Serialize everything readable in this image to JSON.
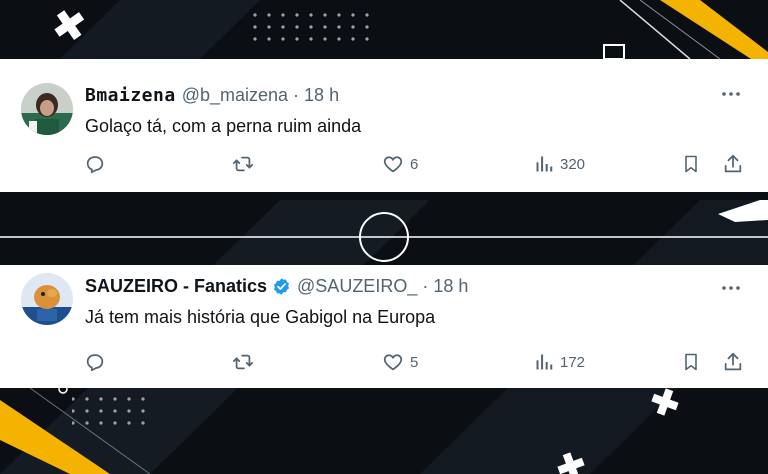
{
  "colors": {
    "background": "#0b0f14",
    "accent_yellow": "#f5b301",
    "verified_blue": "#1d9bf0",
    "text_primary": "#0f1419",
    "text_secondary": "#536471"
  },
  "tweets": [
    {
      "display_name": "Bmaizena",
      "handle": "@b_maizena",
      "separator": "·",
      "time": "18 h",
      "verified": false,
      "text": "Golaço tá, com a perna ruim ainda",
      "likes": "6",
      "views": "320"
    },
    {
      "display_name": "SAUZEIRO - Fanatics",
      "handle": "@SAUZEIRO_",
      "separator": "·",
      "time": "18 h",
      "verified": true,
      "text": "Já tem mais história que Gabigol na Europa",
      "likes": "5",
      "views": "172"
    }
  ],
  "icons": [
    "reply-icon",
    "retweet-icon",
    "like-icon",
    "views-icon",
    "bookmark-icon",
    "share-icon",
    "more-icon",
    "verified-badge-icon"
  ]
}
